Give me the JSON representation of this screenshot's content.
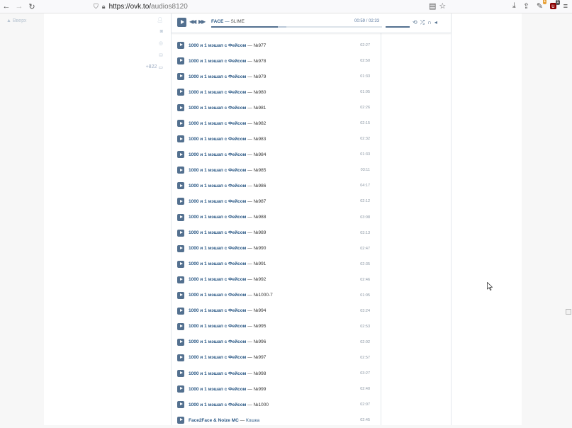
{
  "browser": {
    "url_host": "https://ovk.to/",
    "url_path": "audios8120",
    "download_badge": "1",
    "ublock_badge": "1"
  },
  "page": {
    "back_to_top": "Вверх",
    "menu_counter": "+822"
  },
  "player": {
    "artist": "FACE",
    "dash": " — ",
    "song": "SLIME",
    "time": "00:59 / 02:33",
    "progress": 0.39,
    "buffered": 0.44
  },
  "tracks": [
    {
      "artist": "1000 и 1 мэшап с Фейсом",
      "title": "№977",
      "duration": "02:27"
    },
    {
      "artist": "1000 и 1 мэшап с Фейсом",
      "title": "№978",
      "duration": "02:50"
    },
    {
      "artist": "1000 и 1 мэшап с Фейсом",
      "title": "№979",
      "duration": "01:33"
    },
    {
      "artist": "1000 и 1 мэшап с Фейсом",
      "title": "№980",
      "duration": "01:05"
    },
    {
      "artist": "1000 и 1 мэшап с Фейсом",
      "title": "№981",
      "duration": "02:26"
    },
    {
      "artist": "1000 и 1 мэшап с Фейсом",
      "title": "№982",
      "duration": "02:15"
    },
    {
      "artist": "1000 и 1 мэшап с Фейсом",
      "title": "№983",
      "duration": "02:32"
    },
    {
      "artist": "1000 и 1 мэшап с Фейсом",
      "title": "№984",
      "duration": "01:33"
    },
    {
      "artist": "1000 и 1 мэшап с Фейсом",
      "title": "№985",
      "duration": "03:11"
    },
    {
      "artist": "1000 и 1 мэшап с Фейсом",
      "title": "№986",
      "duration": "04:17"
    },
    {
      "artist": "1000 и 1 мэшап с Фейсом",
      "title": "№987",
      "duration": "02:12"
    },
    {
      "artist": "1000 и 1 мэшап с Фейсом",
      "title": "№988",
      "duration": "03:08"
    },
    {
      "artist": "1000 и 1 мэшап с Фейсом",
      "title": "№989",
      "duration": "03:13"
    },
    {
      "artist": "1000 и 1 мэшап с Фейсом",
      "title": "№990",
      "duration": "02:47"
    },
    {
      "artist": "1000 и 1 мэшап с Фейсом",
      "title": "№991",
      "duration": "02:35"
    },
    {
      "artist": "1000 и 1 мэшап с Фейсом",
      "title": "№992",
      "duration": "02:46"
    },
    {
      "artist": "1000 и 1 мэшап с Фейсом",
      "title": "№1000-7",
      "duration": "01:05"
    },
    {
      "artist": "1000 и 1 мэшап с Фейсом",
      "title": "№994",
      "duration": "03:24"
    },
    {
      "artist": "1000 и 1 мэшап с Фейсом",
      "title": "№995",
      "duration": "02:53"
    },
    {
      "artist": "1000 и 1 мэшап с Фейсом",
      "title": "№996",
      "duration": "02:02"
    },
    {
      "artist": "1000 и 1 мэшап с Фейсом",
      "title": "№997",
      "duration": "02:57"
    },
    {
      "artist": "1000 и 1 мэшап с Фейсом",
      "title": "№998",
      "duration": "03:27"
    },
    {
      "artist": "1000 и 1 мэшап с Фейсом",
      "title": "№999",
      "duration": "02:40"
    },
    {
      "artist": "1000 и 1 мэшап с Фейсом",
      "title": "№1000",
      "duration": "02:07"
    },
    {
      "artist": "Face2Face & Noize MC",
      "title": "Кошка",
      "duration": "02:45",
      "title_link": true
    }
  ],
  "colors": {
    "accent": "#53708f",
    "link": "#2a5885"
  }
}
